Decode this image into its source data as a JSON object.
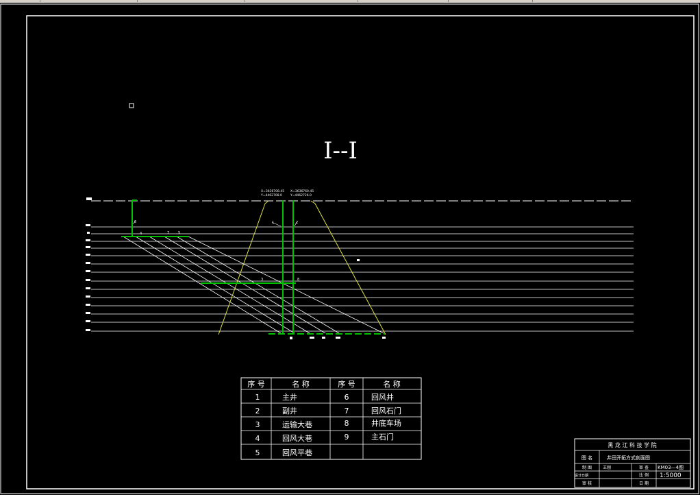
{
  "section_title": "I--I",
  "shaft_labels": {
    "left": [
      "X=3636708.45",
      "Y=4462708.0"
    ],
    "right": [
      "X=3636760.45",
      "Y=4462726.0"
    ]
  },
  "legend": {
    "headers": [
      "序 号",
      "名 称",
      "序 号",
      "名 称"
    ],
    "rows": [
      [
        "1",
        "主井",
        "6",
        "回风井"
      ],
      [
        "2",
        "副井",
        "7",
        "回风石门"
      ],
      [
        "3",
        "运输大巷",
        "8",
        "井底车场"
      ],
      [
        "4",
        "回风大巷",
        "9",
        "主石门"
      ],
      [
        "5",
        "回风平巷",
        "",
        ""
      ]
    ]
  },
  "title_block": {
    "school": "黑 龙 江 科 技 学 院",
    "name_label": "图 名",
    "name_value": "井田开拓方式剖面图",
    "drawn_label": "制 图",
    "drawn_value": "王刚",
    "review_label": "审 查",
    "drawing_no": "KM03—4图",
    "design_label": "设计日期",
    "scale_label": "比 例",
    "scale_value": "1:5000",
    "approve_label": "审 核",
    "date_label": "日 期"
  },
  "colors": {
    "background": "#000000",
    "line": "#ffffff",
    "workings": "#00c000",
    "boundary": "#e0e040"
  }
}
